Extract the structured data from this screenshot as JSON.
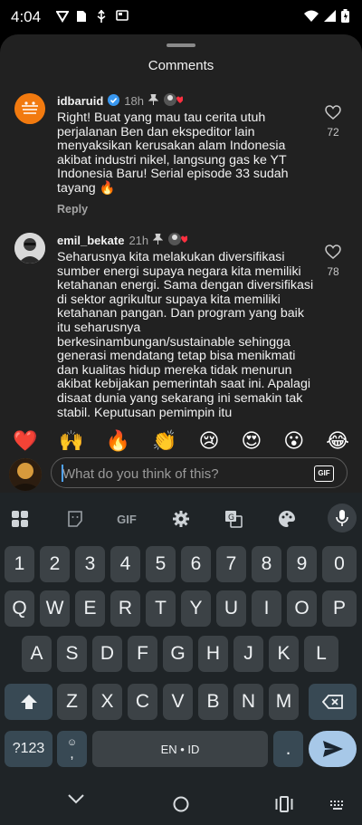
{
  "status_bar": {
    "time": "4:04"
  },
  "sheet": {
    "title": "Comments"
  },
  "comments": [
    {
      "username": "idbaruid",
      "verified": true,
      "time": "18h",
      "pinned": true,
      "text": "Right! Buat yang mau tau cerita utuh perjalanan Ben dan ekspeditor lain menyaksikan kerusakan alam Indonesia akibat industri nikel, langsung gas ke YT Indonesia Baru! Serial episode 33 sudah tayang 🔥",
      "reply_label": "Reply",
      "likes": "72"
    },
    {
      "username": "emil_bekate",
      "verified": false,
      "time": "21h",
      "pinned": true,
      "text": "Seharusnya kita melakukan diversifikasi sumber energi supaya negara kita memiliki ketahanan energi. Sama dengan diversifikasi di sektor agrikultur supaya kita memiliki ketahanan pangan. Dan program yang baik itu seharusnya berkesinambungan/sustainable sehingga generasi mendatang tetap bisa menikmati dan kualitas hidup mereka tidak menurun akibat kebijakan pemerintah saat ini. Apalagi disaat dunia yang sekarang ini semakin tak stabil. Keputusan pemimpin itu",
      "likes": "78"
    }
  ],
  "emoji_reactions": [
    "❤️",
    "🙌",
    "🔥",
    "👏",
    "😢",
    "😍",
    "😮",
    "😂"
  ],
  "comment_input": {
    "placeholder": "What do you think of this?",
    "gif_label": "GIF"
  },
  "keyboard": {
    "toolbar_gif_label": "GIF",
    "row_numbers": [
      "1",
      "2",
      "3",
      "4",
      "5",
      "6",
      "7",
      "8",
      "9",
      "0"
    ],
    "row1": [
      "Q",
      "W",
      "E",
      "R",
      "T",
      "Y",
      "U",
      "I",
      "O",
      "P"
    ],
    "row2": [
      "A",
      "S",
      "D",
      "F",
      "G",
      "H",
      "J",
      "K",
      "L"
    ],
    "row3": [
      "Z",
      "X",
      "C",
      "V",
      "B",
      "N",
      "M"
    ],
    "symbols_label": "?123",
    "space_label": "EN • ID",
    "comma_label": ",",
    "period_label": "."
  }
}
